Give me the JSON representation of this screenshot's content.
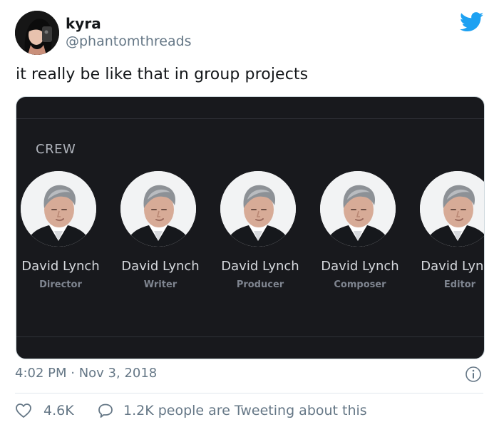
{
  "user": {
    "display_name": "kyra",
    "handle": "@phantomthreads"
  },
  "tweet": {
    "text": "it really be like that in group projects",
    "timestamp": "4:02 PM · Nov 3, 2018"
  },
  "media": {
    "section_label": "CREW",
    "crew": [
      {
        "name": "David Lynch",
        "role": "Director"
      },
      {
        "name": "David Lynch",
        "role": "Writer"
      },
      {
        "name": "David Lynch",
        "role": "Producer"
      },
      {
        "name": "David Lynch",
        "role": "Composer"
      },
      {
        "name": "David Lynch",
        "role": "Editor"
      }
    ]
  },
  "actions": {
    "likes": "4.6K",
    "replies_text": "1.2K people are Tweeting about this"
  },
  "icons": {
    "brand": "twitter-bird-icon",
    "info": "info-icon",
    "like": "heart-icon",
    "reply": "speech-bubble-icon"
  },
  "colors": {
    "brand_blue": "#1da1f2",
    "secondary_text": "#657786",
    "media_bg": "#18191d"
  }
}
